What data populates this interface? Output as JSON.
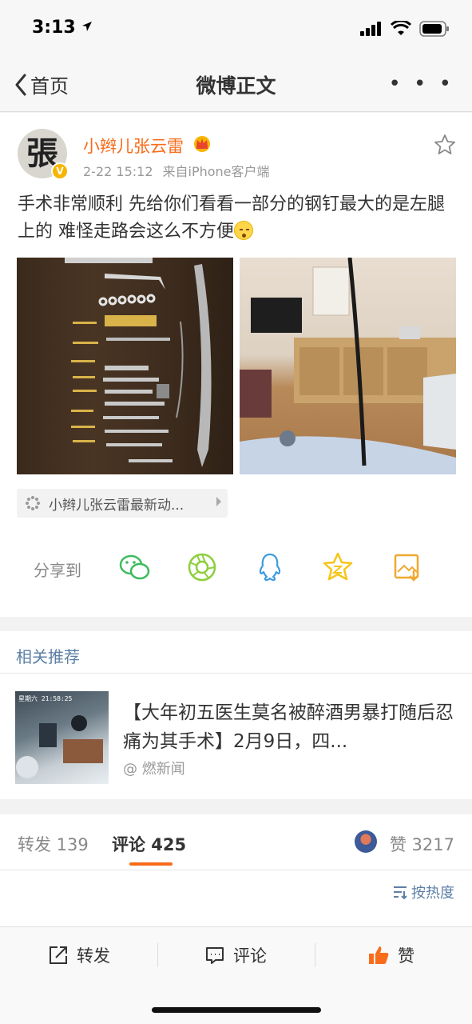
{
  "status_bar": {
    "time": "3:13"
  },
  "nav": {
    "back_label": "首页",
    "title": "微博正文",
    "more_label": "• • •"
  },
  "post": {
    "author": "小辫儿张云雷",
    "avatar_char": "張",
    "verified_mark": "V",
    "time": "2-22 15:12",
    "source": "来自iPhone客户端",
    "text": "手术非常顺利 先给你们看看一部分的钢钉最大的是左腿上的 难怪走路会这么不方便",
    "source_tag": "小辫儿张云雷最新动...",
    "share_label": "分享到",
    "share_icons": [
      "wechat-icon",
      "moments-icon",
      "qq-icon",
      "qzone-icon",
      "save-image-icon"
    ]
  },
  "related": {
    "section_title": "相关推荐",
    "headline": "【大年初五医生莫名被醉酒男暴打随后忍痛为其手术】2月9日，四...",
    "source": "@ 燃新闻",
    "thumb_timestamp": "星期六  21:58:25"
  },
  "stats": {
    "repost_label": "转发 139",
    "comment_label": "评论 425",
    "like_label": "赞 3217"
  },
  "sort": {
    "label": "按热度"
  },
  "toolbar": {
    "repost": "转发",
    "comment": "评论",
    "like": "赞"
  },
  "colors": {
    "accent_orange": "#f86c1b",
    "link_blue": "#5d7fa6",
    "wechat_green": "#3dbb5e",
    "qq_blue": "#3b9be0",
    "qzone_yellow": "#f5c518"
  }
}
